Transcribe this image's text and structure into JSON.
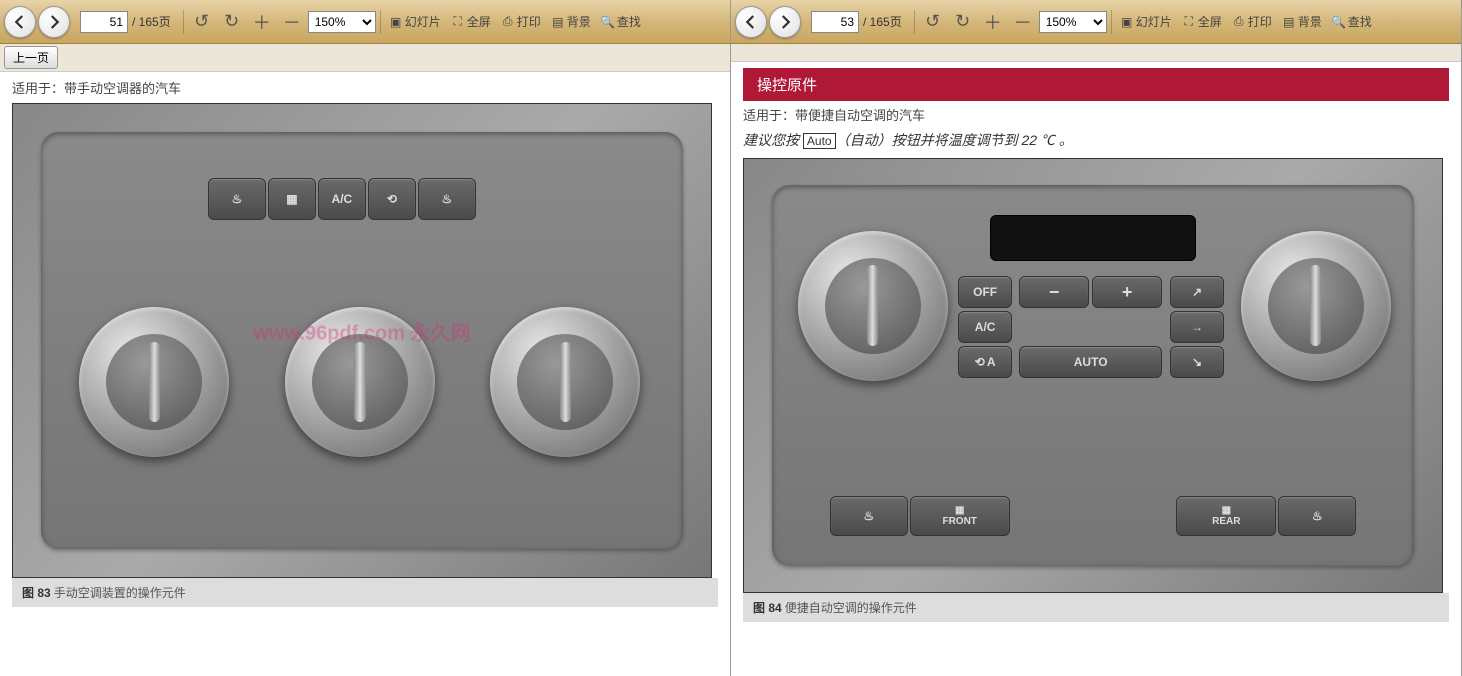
{
  "left": {
    "toolbar": {
      "page_current": "51",
      "page_total": "/ 165页",
      "zoom": "150%",
      "links": {
        "slide": "幻灯片",
        "fullscreen": "全屏",
        "print": "打印",
        "bg": "背景",
        "find": "查找"
      },
      "prev_page_btn": "上一页"
    },
    "subtitle": "适用于：带手动空调器的汽车",
    "caption_prefix": "图 83",
    "caption_text": "手动空调装置的操作元件",
    "panel_buttons": {
      "ac": "A/C"
    }
  },
  "right": {
    "toolbar": {
      "page_current": "53",
      "page_total": "/ 165页",
      "zoom": "150%",
      "links": {
        "slide": "幻灯片",
        "fullscreen": "全屏",
        "print": "打印",
        "bg": "背景",
        "find": "查找"
      }
    },
    "red_header": "操控原件",
    "subtitle": "适用于：带便捷自动空调的汽车",
    "advice_pre": "建议您按 ",
    "advice_auto": "Auto",
    "advice_post": "（自动）按钮并将温度调节到 22 ℃ 。",
    "caption_prefix": "图 84",
    "caption_text": "便捷自动空调的操作元件",
    "panel_buttons": {
      "off": "OFF",
      "ac": "A/C",
      "auto": "AUTO",
      "minus": "−",
      "plus": "+",
      "front": "FRONT",
      "rear": "REAR",
      "a": "A"
    }
  },
  "watermark": "www.96pdf.com 永久网"
}
